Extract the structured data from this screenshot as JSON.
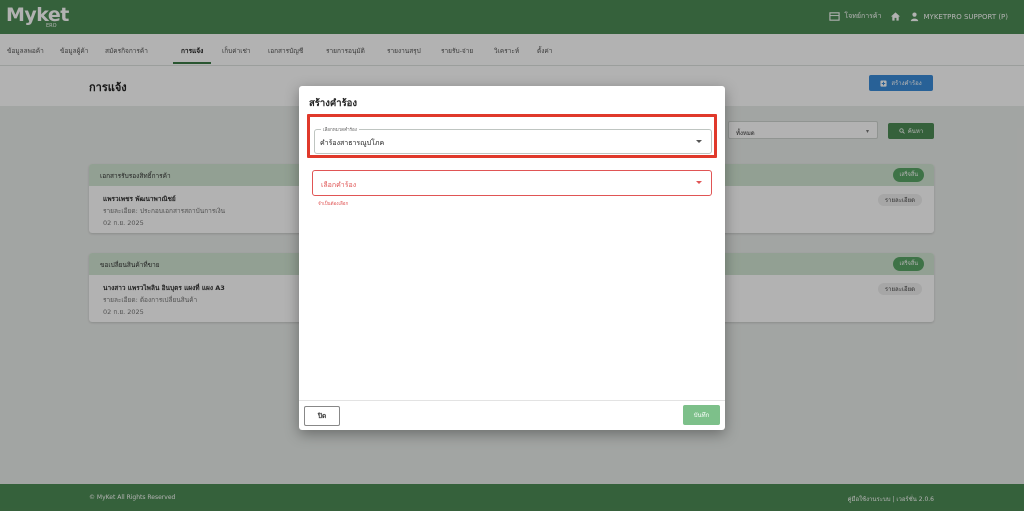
{
  "app": {
    "logo_text": "Myket",
    "logo_sub": "ERO"
  },
  "topbar": {
    "docs_label": "โจทย์การค้า",
    "home_icon": "home-icon",
    "user_label": "MYKETPRO SUPPORT (P)"
  },
  "nav": {
    "tabs": [
      {
        "label": "ข้อมูลลพอค้า",
        "active": false
      },
      {
        "label": "ข้อมูลผู้ค้า",
        "active": false
      },
      {
        "label": "สมัครกิจการค้า",
        "active": false
      },
      {
        "label": "การแจ้ง",
        "active": true
      },
      {
        "label": "เก็บค่าเช่า",
        "active": false
      },
      {
        "label": "เอกสารบัญชี",
        "active": false
      },
      {
        "label": "รายการอนุมัติ",
        "active": false
      },
      {
        "label": "รายงานสรุป",
        "active": false
      },
      {
        "label": "รายรับ-จ่าย",
        "active": false
      },
      {
        "label": "วิเคราะห์",
        "active": false
      },
      {
        "label": "ตั้งค่า",
        "active": false
      }
    ]
  },
  "page": {
    "title": "การแจ้ง",
    "create_button": "สร้างคำร้อง"
  },
  "filters": {
    "status_value": "ทั้งหมด",
    "search_button": "ค้นหา"
  },
  "cards": [
    {
      "category": "เอกสารรับรองสิทธิ์การค้า",
      "badge": "เสร็จสิ้น",
      "name": "แพรวเพชร พัฒนาพาณิชย์",
      "description": "รายละเอียด: ประกอบเอกสารสถาบันการเงิน",
      "date": "02 ก.ย. 2025",
      "detail_button": "รายละเอียด"
    },
    {
      "category": "ขอเปลี่ยนสินค้าที่ขาย",
      "badge": "เสร็จสิ้น",
      "name": "นางสาว แพรวไพลิน อินบุตร แผงที่ แผง A3",
      "description": "รายละเอียด: ต้องการเปลี่ยนสินค้า",
      "date": "02 ก.ย. 2025",
      "detail_button": "รายละเอียด"
    }
  ],
  "modal": {
    "title": "สร้างคำร้อง",
    "category_label": "เลือกหมวดคำร้อง",
    "category_value": "คำร้องสาธารณูปโภค",
    "request_placeholder": "เลือกคำร้อง",
    "request_helper": "จำเป็นต้องเลือก",
    "close_button": "ปิด",
    "save_button": "บันทึก"
  },
  "footer": {
    "copyright": "© MyKet All Rights Reserved",
    "version": "คู่มือใช้งานระบบ | เวอร์ชั่น 2.0.6"
  },
  "colors": {
    "primary_green": "#4d8b55",
    "highlight_red": "#e0392b",
    "error_red": "#e05555",
    "accent_blue": "#3a8bd8"
  }
}
